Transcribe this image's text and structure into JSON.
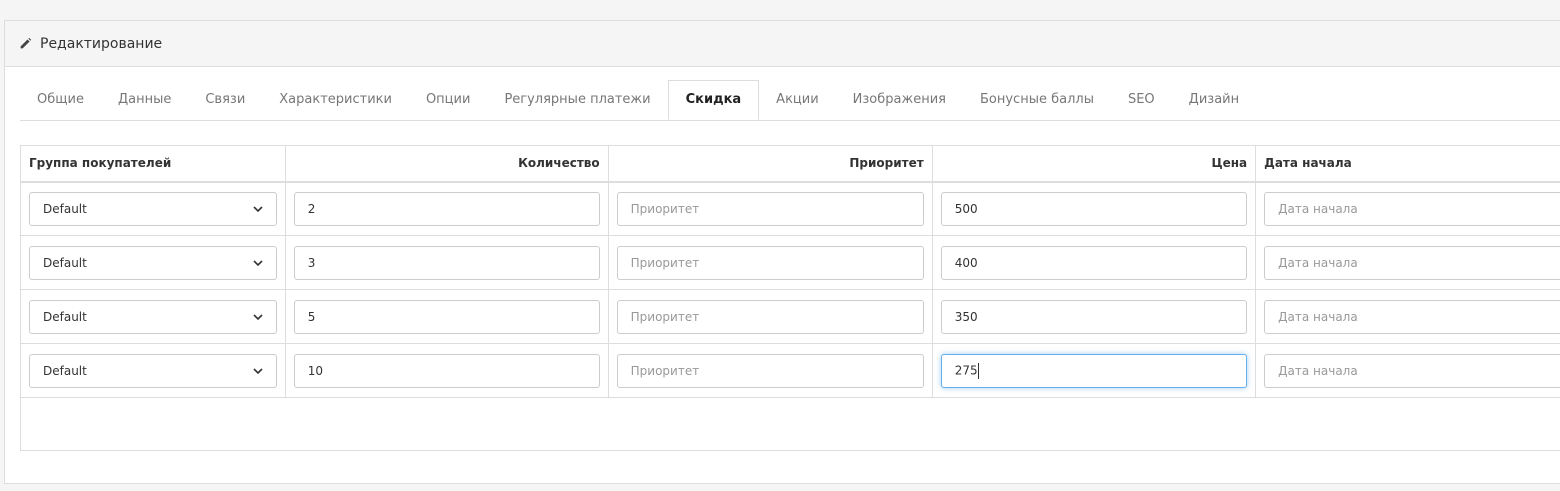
{
  "header": {
    "title": "Редактирование",
    "icon": "pencil-icon"
  },
  "tabs": [
    {
      "label": "Общие"
    },
    {
      "label": "Данные"
    },
    {
      "label": "Связи"
    },
    {
      "label": "Характеристики"
    },
    {
      "label": "Опции"
    },
    {
      "label": "Регулярные платежи"
    },
    {
      "label": "Скидка",
      "active": true
    },
    {
      "label": "Акции"
    },
    {
      "label": "Изображения"
    },
    {
      "label": "Бонусные баллы"
    },
    {
      "label": "SEO"
    },
    {
      "label": "Дизайн"
    }
  ],
  "table": {
    "columns": [
      "Группа покупателей",
      "Количество",
      "Приоритет",
      "Цена",
      "Дата начала"
    ],
    "placeholders": {
      "priority": "Приоритет",
      "date_start": "Дата начала"
    },
    "rows": [
      {
        "group": "Default",
        "quantity": "2",
        "priority": "",
        "price": "500",
        "date_start": ""
      },
      {
        "group": "Default",
        "quantity": "3",
        "priority": "",
        "price": "400",
        "date_start": ""
      },
      {
        "group": "Default",
        "quantity": "5",
        "priority": "",
        "price": "350",
        "date_start": ""
      },
      {
        "group": "Default",
        "quantity": "10",
        "priority": "",
        "price": "275",
        "date_start": "",
        "focused": true
      }
    ]
  },
  "colors": {
    "focus_border": "#66afe9"
  }
}
